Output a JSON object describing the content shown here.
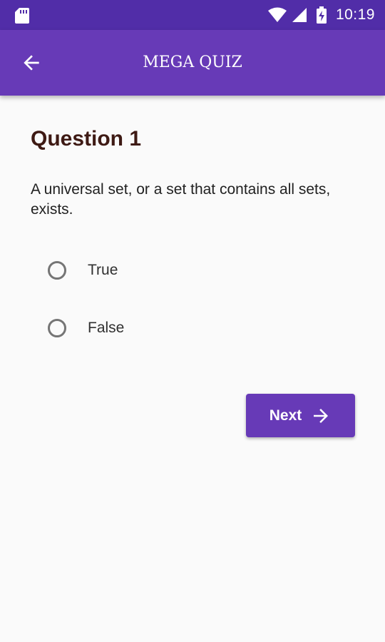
{
  "status_bar": {
    "time": "10:19",
    "icons": [
      "sd-card-icon",
      "wifi-icon",
      "signal-icon",
      "battery-charging-icon"
    ]
  },
  "app_bar": {
    "title": "MEGA QUIZ",
    "back_icon": "arrow-back-icon"
  },
  "question": {
    "title": "Question 1",
    "text": "A universal set, or a set that contains all sets, exists.",
    "options": [
      {
        "label": "True",
        "selected": false
      },
      {
        "label": "False",
        "selected": false
      }
    ]
  },
  "next_button": {
    "label": "Next",
    "icon": "arrow-forward-icon"
  },
  "colors": {
    "status_bar": "#512da8",
    "primary": "#673ab7",
    "title_text": "#3e1a14",
    "background": "#fafafa"
  }
}
